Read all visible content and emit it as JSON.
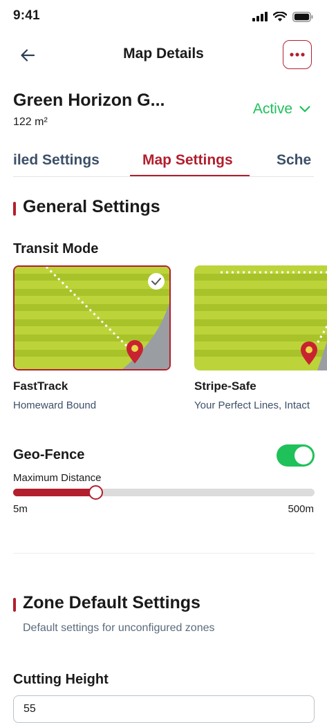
{
  "status_bar": {
    "time": "9:41"
  },
  "header": {
    "title": "Map Details"
  },
  "map": {
    "name": "Green Horizon G...",
    "area": "122 m²",
    "status": "Active"
  },
  "tabs": [
    {
      "label": "iled Settings"
    },
    {
      "label": "Map Settings"
    },
    {
      "label": "Sche"
    }
  ],
  "general": {
    "title": "General Settings",
    "transit_mode": {
      "label": "Transit Mode",
      "options": [
        {
          "title": "FastTrack",
          "subtitle": "Homeward Bound",
          "selected": true
        },
        {
          "title": "Stripe-Safe",
          "subtitle": "Your Perfect Lines, Intact",
          "selected": false
        }
      ]
    },
    "geo_fence": {
      "label": "Geo-Fence",
      "enabled": true,
      "slider_label": "Maximum Distance",
      "min_label": "5m",
      "max_label": "500m",
      "fraction": 0.275
    }
  },
  "zone_defaults": {
    "title": "Zone Default Settings",
    "description": "Default settings for unconfigured zones"
  },
  "cutting_height": {
    "label": "Cutting Height",
    "value": "55"
  },
  "colors": {
    "accent": "#b21f2d",
    "active_green": "#1fc15a",
    "grass_light": "#bcd43a",
    "grass_dark": "#a8c22a"
  }
}
